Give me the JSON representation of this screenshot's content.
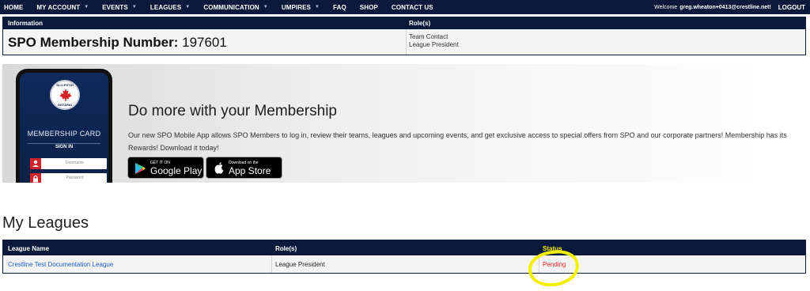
{
  "nav": {
    "items": [
      {
        "label": "HOME",
        "caret": false
      },
      {
        "label": "MY ACCOUNT",
        "caret": true
      },
      {
        "label": "EVENTS",
        "caret": true
      },
      {
        "label": "LEAGUES",
        "caret": true
      },
      {
        "label": "COMMUNICATION",
        "caret": true
      },
      {
        "label": "UMPIRES",
        "caret": true
      },
      {
        "label": "FAQ",
        "caret": false
      },
      {
        "label": "SHOP",
        "caret": false
      },
      {
        "label": "CONTACT US",
        "caret": false
      }
    ],
    "welcome_prefix": "Welcome",
    "welcome_user": "greg.wheaton+0413@crestline.net!",
    "logout_label": "LOGOUT"
  },
  "info_table": {
    "headers": {
      "information": "Information",
      "roles": "Role(s)"
    },
    "member_label": "SPO Membership Number:",
    "member_number": "197601",
    "roles": [
      "Team Contact",
      "League President"
    ]
  },
  "promo": {
    "phone": {
      "logo_top": "SLO-PITCH",
      "logo_bottom": "ONTARIO",
      "card_title": "MEMBERSHIP CARD",
      "signin": "SIGN IN",
      "username_placeholder": "Username",
      "password_placeholder": "Password"
    },
    "title": "Do more with your Membership",
    "text": "Our new SPO Mobile App allows SPO Members to log in, review their teams, leagues and upcoming events, and get exclusive access to special offers from SPO and our corporate partners! Membership has its Rewards! Download it today!",
    "google_play": {
      "small": "GET IT ON",
      "big": "Google Play"
    },
    "app_store": {
      "small": "Download on the",
      "big": "App Store"
    }
  },
  "my_leagues": {
    "title": "My Leagues",
    "headers": {
      "league_name": "League Name",
      "roles": "Role(s)",
      "status": "Status"
    },
    "rows": [
      {
        "league_name": "Crestline Test Documentation League",
        "role": "League President",
        "status": "Pending"
      }
    ]
  },
  "colors": {
    "navy": "#0b1a3a",
    "link": "#1d5bbf",
    "pending": "#e02424",
    "highlight": "#f3f000"
  }
}
